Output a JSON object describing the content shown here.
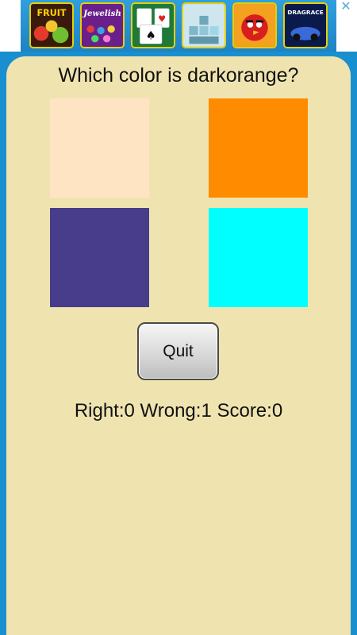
{
  "ad_banner": {
    "close_icon": "close-icon",
    "thumbnails": [
      {
        "name": "fruit-game-thumbnail",
        "text": "FRUIT"
      },
      {
        "name": "jewelish-game-thumbnail",
        "text": "Jewelish"
      },
      {
        "name": "solitaire-game-thumbnail",
        "text": ""
      },
      {
        "name": "block-puzzle-game-thumbnail",
        "text": ""
      },
      {
        "name": "angry-birds-game-thumbnail",
        "text": ""
      },
      {
        "name": "drag-race-game-thumbnail",
        "text": "DRAGRACE"
      }
    ]
  },
  "quiz": {
    "question": "Which color is darkorange?",
    "options": [
      {
        "color": "#ffe4c4"
      },
      {
        "color": "#ff8c00"
      },
      {
        "color": "#483d8b"
      },
      {
        "color": "#00ffff"
      }
    ],
    "quit_label": "Quit",
    "score_text": "Right:0 Wrong:1 Score:0"
  }
}
